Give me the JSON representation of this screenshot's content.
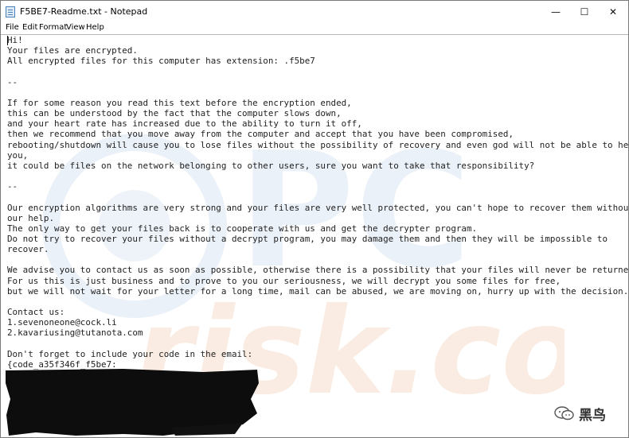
{
  "window": {
    "title": "F5BE7-Readme.txt - Notepad",
    "controls": {
      "minimize": "—",
      "maximize": "☐",
      "close": "✕"
    }
  },
  "menu": [
    "File",
    "Edit",
    "Format",
    "View",
    "Help"
  ],
  "document": {
    "lines": [
      "Hi!",
      "Your files are encrypted.",
      "All encrypted files for this computer has extension: .f5be7",
      "",
      "--",
      "",
      "If for some reason you read this text before the encryption ended,",
      "this can be understood by the fact that the computer slows down,",
      "and your heart rate has increased due to the ability to turn it off,",
      "then we recommend that you move away from the computer and accept that you have been compromised,",
      "rebooting/shutdown will cause you to lose files without the possibility of recovery and even god will not be able to help",
      "you,",
      "it could be files on the network belonging to other users, sure you want to take that responsibility?",
      "",
      "--",
      "",
      "Our encryption algorithms are very strong and your files are very well protected, you can't hope to recover them without",
      "our help.",
      "The only way to get your files back is to cooperate with us and get the decrypter program.",
      "Do not try to recover your files without a decrypt program, you may damage them and then they will be impossible to",
      "recover.",
      "",
      "We advise you to contact us as soon as possible, otherwise there is a possibility that your files will never be returned.",
      "For us this is just business and to prove to you our seriousness, we will decrypt you some files for free,",
      "but we will not wait for your letter for a long time, mail can be abused, we are moving on, hurry up with the decision.",
      "",
      "Contact us:",
      "1.sevenoneone@cock.li",
      "2.kavariusing@tutanota.com",
      "",
      "Don't forget to include your code in the email:",
      "{code_a35f346f_f5be7:"
    ]
  },
  "watermark": {
    "top": "PC",
    "bottom": "risk.com"
  },
  "badge": {
    "label": "黑鸟"
  }
}
